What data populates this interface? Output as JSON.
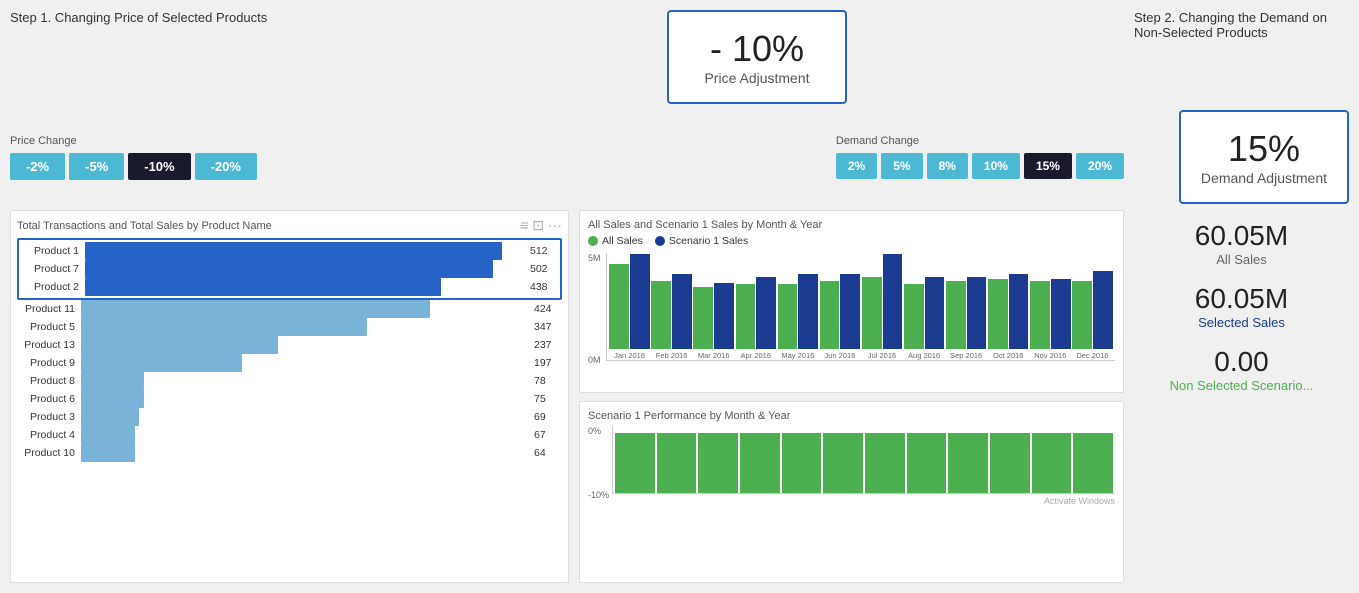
{
  "step1": {
    "label": "Step 1. Changing Price of Selected Products",
    "priceChange": {
      "title": "Price Change",
      "buttons": [
        "-2%",
        "-5%",
        "-10%",
        "-20%"
      ],
      "activeIndex": 2
    }
  },
  "step2": {
    "label": "Step 2. Changing the Demand on Non-Selected Products",
    "demandChange": {
      "title": "Demand Change",
      "buttons": [
        "2%",
        "5%",
        "8%",
        "10%",
        "15%",
        "20%"
      ],
      "activeIndex": 4
    }
  },
  "priceAdjustment": {
    "value": "- 10%",
    "label": "Price Adjustment"
  },
  "demandAdjustment": {
    "value": "15%",
    "label": "Demand Adjustment"
  },
  "barChart": {
    "title": "Total Transactions and Total Sales by Product Name",
    "products": [
      {
        "name": "Product 1",
        "value": 512,
        "widthPct": 95,
        "selected": true
      },
      {
        "name": "Product 7",
        "value": 502,
        "widthPct": 93,
        "selected": true
      },
      {
        "name": "Product 2",
        "value": 438,
        "widthPct": 81,
        "selected": true
      },
      {
        "name": "Product 11",
        "value": 424,
        "widthPct": 78,
        "selected": false
      },
      {
        "name": "Product 5",
        "value": 347,
        "widthPct": 64,
        "selected": false
      },
      {
        "name": "Product 13",
        "value": 237,
        "widthPct": 44,
        "selected": false
      },
      {
        "name": "Product 9",
        "value": 197,
        "widthPct": 36,
        "selected": false
      },
      {
        "name": "Product 8",
        "value": 78,
        "widthPct": 14,
        "selected": false
      },
      {
        "name": "Product 6",
        "value": 75,
        "widthPct": 14,
        "selected": false
      },
      {
        "name": "Product 3",
        "value": 69,
        "widthPct": 13,
        "selected": false
      },
      {
        "name": "Product 4",
        "value": 67,
        "widthPct": 12,
        "selected": false
      },
      {
        "name": "Product 10",
        "value": 64,
        "widthPct": 12,
        "selected": false
      }
    ]
  },
  "lineBarChart": {
    "title": "All Sales and Scenario 1 Sales by Month & Year",
    "legend": [
      "All Sales",
      "Scenario 1 Sales"
    ],
    "months": [
      {
        "label": "Jan 2016",
        "allSales": 130,
        "scenSales": 145
      },
      {
        "label": "Feb 2016",
        "allSales": 105,
        "scenSales": 115
      },
      {
        "label": "Mar 2016",
        "allSales": 95,
        "scenSales": 100
      },
      {
        "label": "Apr 2016",
        "allSales": 100,
        "scenSales": 110
      },
      {
        "label": "May 2016",
        "allSales": 100,
        "scenSales": 115
      },
      {
        "label": "Jun 2016",
        "allSales": 105,
        "scenSales": 115
      },
      {
        "label": "Jul 2016",
        "allSales": 110,
        "scenSales": 145
      },
      {
        "label": "Aug 2016",
        "allSales": 100,
        "scenSales": 110
      },
      {
        "label": "Sep 2016",
        "allSales": 105,
        "scenSales": 110
      },
      {
        "label": "Oct 2016",
        "allSales": 108,
        "scenSales": 115
      },
      {
        "label": "Nov 2016",
        "allSales": 105,
        "scenSales": 108
      },
      {
        "label": "Dec 2016",
        "allSales": 105,
        "scenSales": 120
      }
    ],
    "yLabels": [
      "5M",
      "0M"
    ]
  },
  "scenarioChart": {
    "title": "Scenario 1 Performance by Month & Year",
    "yLabels": [
      "0%",
      "-10%"
    ],
    "bars": [
      80,
      80,
      80,
      80,
      80,
      80,
      80,
      80,
      80,
      80,
      80,
      80
    ]
  },
  "stats": {
    "allSales": {
      "value": "60.05M",
      "label": "All Sales"
    },
    "selectedSales": {
      "value": "60.05M",
      "label": "Selected Sales"
    },
    "nonSelectedScenario": {
      "value": "0.00",
      "label": "Non Selected Scenario..."
    }
  },
  "watermark": "Activate Windows"
}
